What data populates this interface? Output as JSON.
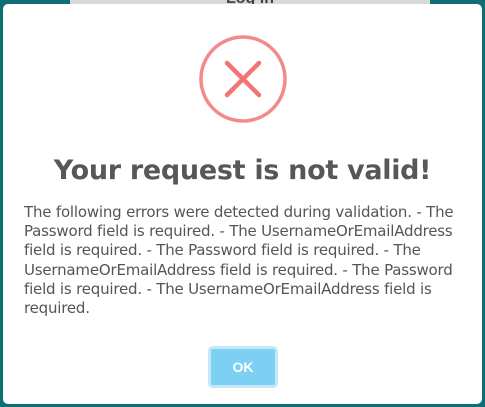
{
  "background": {
    "title": "Log in",
    "color": "#0e6e75"
  },
  "dialog": {
    "icon": "error-x-circle-icon",
    "icon_color": "#f27474",
    "title": "Your request is not valid!",
    "message": "The following errors were detected during validation. - The Password field is required. - The UsernameOrEmailAddress field is required. - The Password field is required. - The UsernameOrEmailAddress field is required. - The Password field is required. - The UsernameOrEmailAddress field is required.",
    "ok_label": "OK",
    "ok_color": "#7ecff4"
  }
}
